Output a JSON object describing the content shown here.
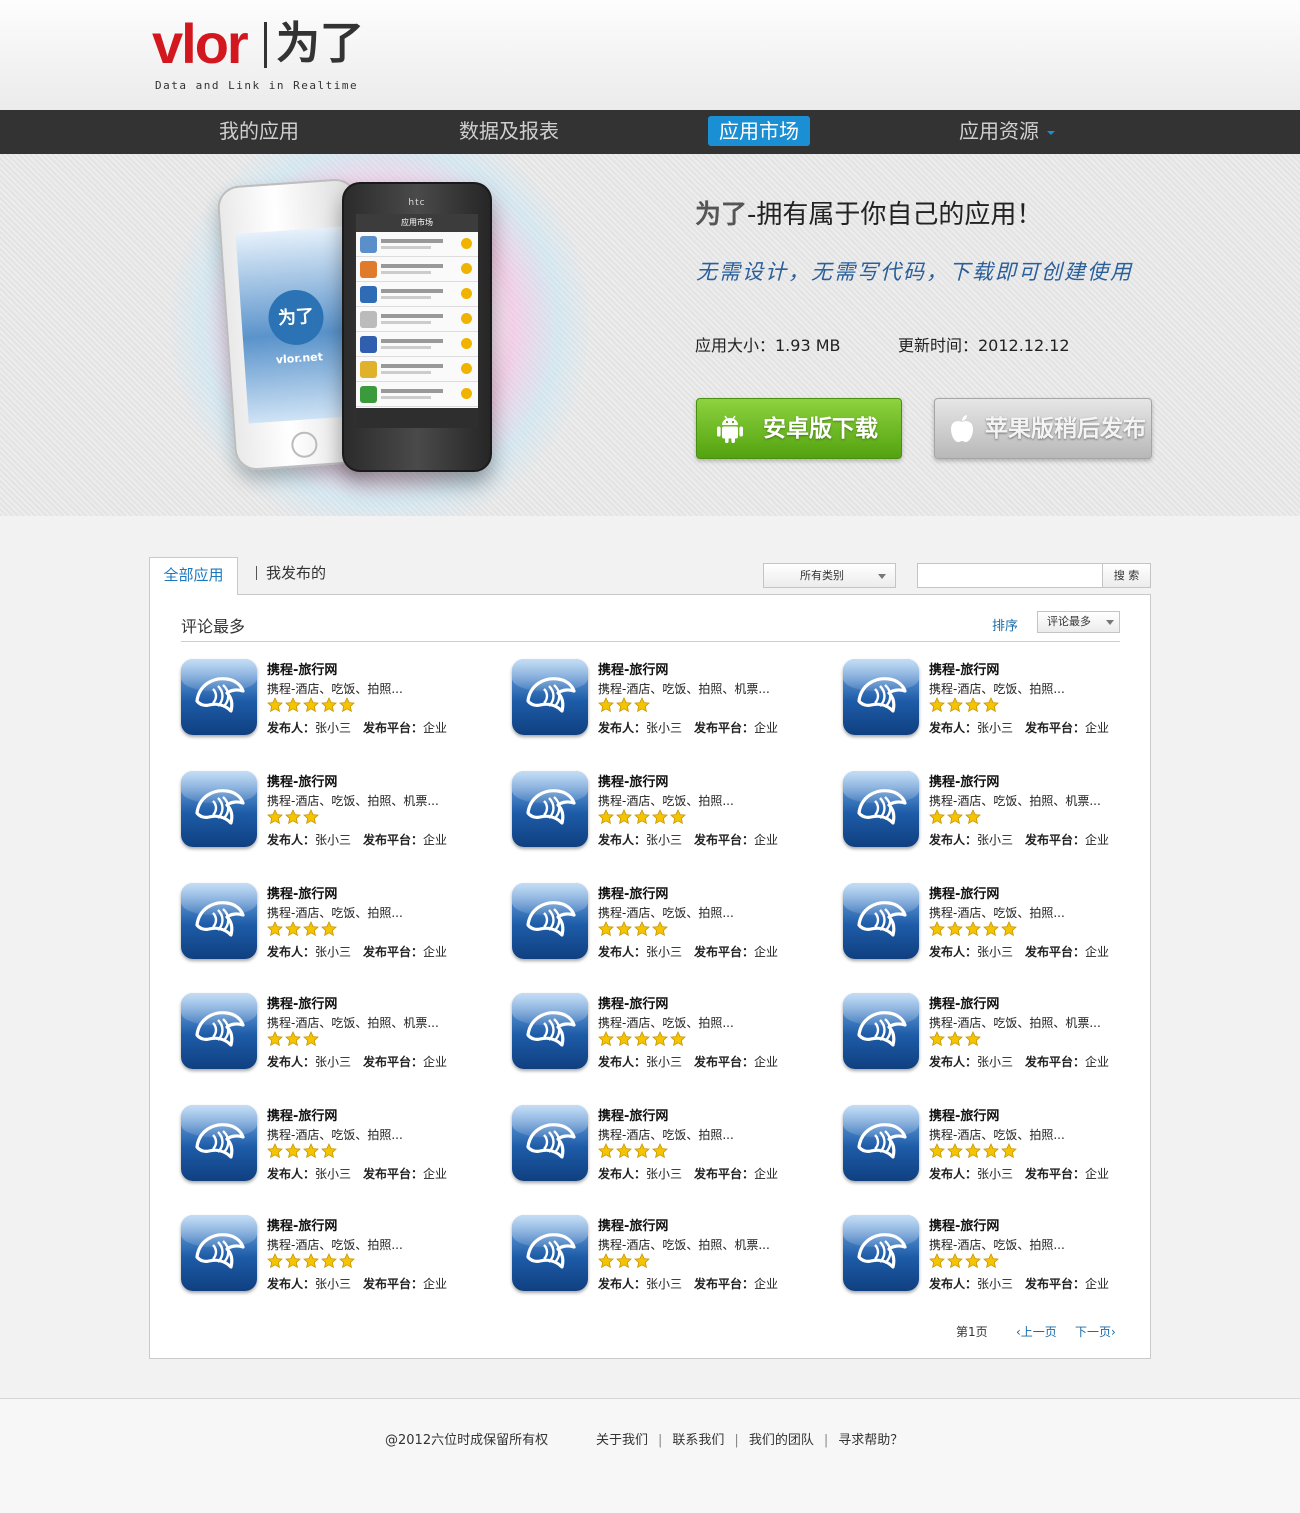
{
  "header": {
    "logo_brand": "vlor",
    "logo_cn": "为了",
    "logo_tagline": "Data and Link in Realtime"
  },
  "nav": {
    "items": [
      {
        "label": "我的应用"
      },
      {
        "label": "数据及报表"
      },
      {
        "label": "应用市场",
        "active": true
      },
      {
        "label": "应用资源",
        "dropdown": true
      }
    ]
  },
  "hero": {
    "title_brand": "为了",
    "title_rest": "-拥有属于你自己的应用！",
    "subtitle": "无需设计，无需写代码，下载即可创建使用",
    "size_text": "应用大小：1.93 MB",
    "updated_text": "更新时间：2012.12.12",
    "android_button": "安卓版下载",
    "apple_button": "苹果版稍后发布",
    "iphone_site": "vlor.net",
    "iphone_logo": "为了",
    "android_phone_brand": "htc",
    "android_phone_title": "应用市场"
  },
  "tabs": {
    "all": "全部应用",
    "mine": "我发布的"
  },
  "filters": {
    "category": "所有类别",
    "search_placeholder": "",
    "search_button": "搜 索"
  },
  "panel": {
    "title": "评论最多",
    "sort_label": "排序",
    "sort_value": "评论最多"
  },
  "apps": [
    {
      "name": "携程-旅行网",
      "desc": "携程-酒店、吃饭、拍照...",
      "rating": 5,
      "publisher_label": "发布人：",
      "publisher": "张小三",
      "platform_label": "发布平台：",
      "platform": "企业"
    },
    {
      "name": "携程-旅行网",
      "desc": "携程-酒店、吃饭、拍照、机票...",
      "rating": 3,
      "publisher_label": "发布人：",
      "publisher": "张小三",
      "platform_label": "发布平台：",
      "platform": "企业"
    },
    {
      "name": "携程-旅行网",
      "desc": "携程-酒店、吃饭、拍照...",
      "rating": 4,
      "publisher_label": "发布人：",
      "publisher": "张小三",
      "platform_label": "发布平台：",
      "platform": "企业"
    },
    {
      "name": "携程-旅行网",
      "desc": "携程-酒店、吃饭、拍照、机票...",
      "rating": 3,
      "publisher_label": "发布人：",
      "publisher": "张小三",
      "platform_label": "发布平台：",
      "platform": "企业"
    },
    {
      "name": "携程-旅行网",
      "desc": "携程-酒店、吃饭、拍照...",
      "rating": 5,
      "publisher_label": "发布人：",
      "publisher": "张小三",
      "platform_label": "发布平台：",
      "platform": "企业"
    },
    {
      "name": "携程-旅行网",
      "desc": "携程-酒店、吃饭、拍照、机票...",
      "rating": 3,
      "publisher_label": "发布人：",
      "publisher": "张小三",
      "platform_label": "发布平台：",
      "platform": "企业"
    },
    {
      "name": "携程-旅行网",
      "desc": "携程-酒店、吃饭、拍照...",
      "rating": 4,
      "publisher_label": "发布人：",
      "publisher": "张小三",
      "platform_label": "发布平台：",
      "platform": "企业"
    },
    {
      "name": "携程-旅行网",
      "desc": "携程-酒店、吃饭、拍照...",
      "rating": 4,
      "publisher_label": "发布人：",
      "publisher": "张小三",
      "platform_label": "发布平台：",
      "platform": "企业"
    },
    {
      "name": "携程-旅行网",
      "desc": "携程-酒店、吃饭、拍照...",
      "rating": 5,
      "publisher_label": "发布人：",
      "publisher": "张小三",
      "platform_label": "发布平台：",
      "platform": "企业"
    },
    {
      "name": "携程-旅行网",
      "desc": "携程-酒店、吃饭、拍照、机票...",
      "rating": 3,
      "publisher_label": "发布人：",
      "publisher": "张小三",
      "platform_label": "发布平台：",
      "platform": "企业"
    },
    {
      "name": "携程-旅行网",
      "desc": "携程-酒店、吃饭、拍照...",
      "rating": 5,
      "publisher_label": "发布人：",
      "publisher": "张小三",
      "platform_label": "发布平台：",
      "platform": "企业"
    },
    {
      "name": "携程-旅行网",
      "desc": "携程-酒店、吃饭、拍照、机票...",
      "rating": 3,
      "publisher_label": "发布人：",
      "publisher": "张小三",
      "platform_label": "发布平台：",
      "platform": "企业"
    },
    {
      "name": "携程-旅行网",
      "desc": "携程-酒店、吃饭、拍照...",
      "rating": 4,
      "publisher_label": "发布人：",
      "publisher": "张小三",
      "platform_label": "发布平台：",
      "platform": "企业"
    },
    {
      "name": "携程-旅行网",
      "desc": "携程-酒店、吃饭、拍照...",
      "rating": 4,
      "publisher_label": "发布人：",
      "publisher": "张小三",
      "platform_label": "发布平台：",
      "platform": "企业"
    },
    {
      "name": "携程-旅行网",
      "desc": "携程-酒店、吃饭、拍照...",
      "rating": 5,
      "publisher_label": "发布人：",
      "publisher": "张小三",
      "platform_label": "发布平台：",
      "platform": "企业"
    },
    {
      "name": "携程-旅行网",
      "desc": "携程-酒店、吃饭、拍照...",
      "rating": 5,
      "publisher_label": "发布人：",
      "publisher": "张小三",
      "platform_label": "发布平台：",
      "platform": "企业"
    },
    {
      "name": "携程-旅行网",
      "desc": "携程-酒店、吃饭、拍照、机票...",
      "rating": 3,
      "publisher_label": "发布人：",
      "publisher": "张小三",
      "platform_label": "发布平台：",
      "platform": "企业"
    },
    {
      "name": "携程-旅行网",
      "desc": "携程-酒店、吃饭、拍照...",
      "rating": 4,
      "publisher_label": "发布人：",
      "publisher": "张小三",
      "platform_label": "发布平台：",
      "platform": "企业"
    }
  ],
  "pager": {
    "current": "第1页",
    "prev": "‹上一页",
    "next": "下一页›"
  },
  "footer": {
    "copyright": "@2012六位时成保留所有权",
    "links": [
      "关于我们",
      "联系我们",
      "我们的团队",
      "寻求帮助？"
    ]
  },
  "colors": {
    "accent": "#1b8fd3",
    "nav_bg": "#333333",
    "logo_red": "#d3171f",
    "android_green": "#6bbd23",
    "star_gold": "#f5c400"
  }
}
